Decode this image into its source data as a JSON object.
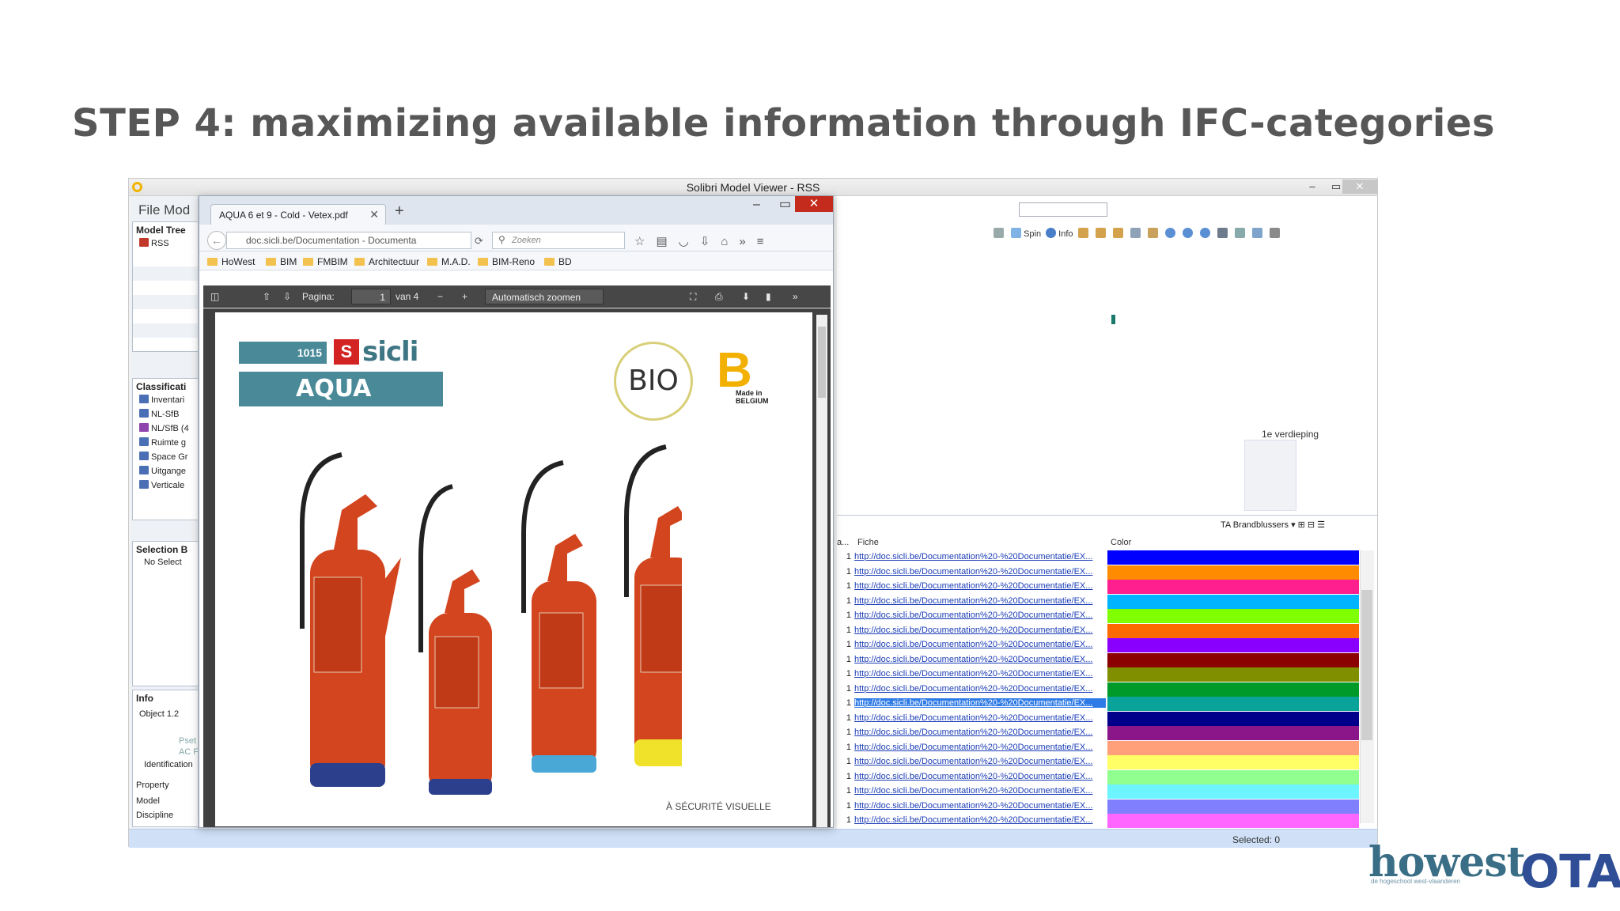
{
  "slide": {
    "title": "STEP 4: maximizing available information through IFC-categories"
  },
  "solibri": {
    "title": "Solibri Model Viewer - RSS",
    "window_buttons": {
      "minimize": "–",
      "maximize": "▭",
      "close": "✕"
    },
    "menu": "File  Mod",
    "model_tree": {
      "title": "Model Tree",
      "items": [
        "RSS"
      ]
    },
    "classification": {
      "title": "Classificati",
      "items": [
        "Inventari",
        "NL-SfB",
        "NL/SfB (4",
        "Ruimte g",
        "Space Gr",
        "Uitgange",
        "Verticale"
      ]
    },
    "selection": {
      "title": "Selection B",
      "item": "No Select"
    },
    "info": {
      "title": "Info",
      "object": "Object 1.2",
      "tabs": [
        "Pset",
        "AC F"
      ],
      "rows": [
        "Identification",
        "Property",
        "Model",
        "Discipline"
      ]
    },
    "toolbar": {
      "spin": "Spin",
      "info": "Info"
    },
    "floor_label": "1e verdieping",
    "table": {
      "toolbar_label": "TA Brandblussers",
      "columns": [
        "a...",
        "Fiche",
        "Color"
      ],
      "url_text": "http://doc.sicli.be/Documentation%20-%20Documentatie/EX...",
      "qty": "1",
      "selected_row": 10,
      "row_colors": [
        "#0000ff",
        "#ff8c00",
        "#ff1f8e",
        "#00b4ff",
        "#80ff00",
        "#ff6a00",
        "#8a00ff",
        "#8b0000",
        "#7f8f00",
        "#009a2a",
        "#0aa39a",
        "#00008b",
        "#8a168a",
        "#ffa07a",
        "#ffff66",
        "#90ff90",
        "#6cf5ff",
        "#8080ff",
        "#ff66ff"
      ]
    },
    "status": "Selected: 0"
  },
  "firefox": {
    "tab_title": "AQUA 6 et 9 - Cold - Vetex.pdf",
    "url": "doc.sicli.be/Documentation - Documenta",
    "search_placeholder": "Zoeken",
    "bookmarks": [
      "HoWest",
      "BIM",
      "FMBIM",
      "Architectuur",
      "M.A.D.",
      "BIM-Reno",
      "BD"
    ],
    "pdf": {
      "page_label": "Pagina:",
      "page_value": "1",
      "page_total": "van 4",
      "zoom_label": "Automatisch zoomen",
      "content": {
        "product_number": "1015",
        "brand": "sicli",
        "product": "AQUA",
        "bio": "BIO",
        "made_in": "Made in BELGIUM",
        "safety": "À SÉCURITÉ VISUELLE"
      }
    }
  },
  "logos": {
    "howest": "howest",
    "howest_sub": "de hogeschool west-vlaanderen",
    "ota": "OTA"
  }
}
